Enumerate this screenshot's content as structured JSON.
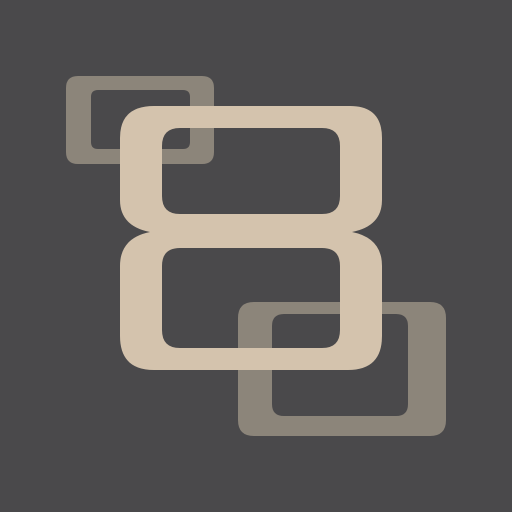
{
  "icon": {
    "name": "eight-in-linked-rectangles-logo",
    "glyph": "8"
  },
  "colors": {
    "background": "#4a494b",
    "glyph": "#d4c3ad",
    "outline_shape": "#8c857a"
  }
}
